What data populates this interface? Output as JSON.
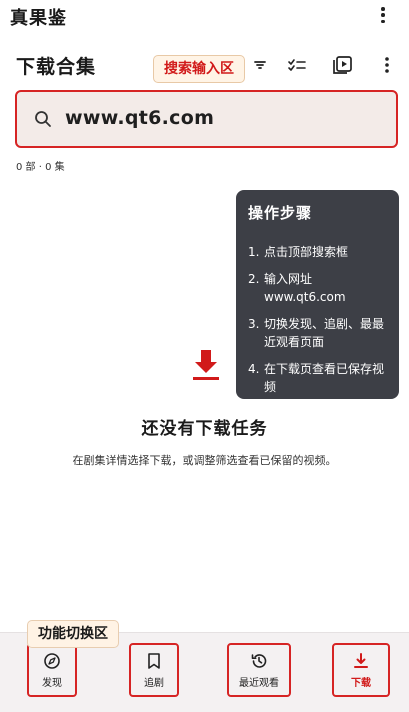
{
  "app": {
    "title": "真果鉴"
  },
  "header": {
    "title": "下载合集"
  },
  "annotations": {
    "search_area": "搜索输入区",
    "function_switch": "功能切换区"
  },
  "search": {
    "value": "www.qt6.com"
  },
  "status": {
    "count": "0 部 · 0 集"
  },
  "steps": {
    "title": "操作步骤",
    "items": [
      {
        "num": "1.",
        "text": "点击顶部搜索框"
      },
      {
        "num": "2.",
        "text": "输入网址 www.qt6.com"
      },
      {
        "num": "3.",
        "text": "切换发现、追剧、最最近观看页面"
      },
      {
        "num": "4.",
        "text": "在下载页查看已保存视频"
      }
    ]
  },
  "empty": {
    "title": "还没有下载任务",
    "subtitle": "在剧集详情选择下载，或调整筛选查看已保留的视频。"
  },
  "nav": {
    "items": [
      {
        "label": "发现",
        "icon": "compass-icon"
      },
      {
        "label": "追剧",
        "icon": "bookmark-icon"
      },
      {
        "label": "最近观看",
        "icon": "history-icon"
      },
      {
        "label": "下载",
        "icon": "download-icon",
        "active": true
      }
    ]
  },
  "colors": {
    "accent": "#d11a1a",
    "tooltip_bg": "#3d3f46",
    "search_bg": "#f3ebe8",
    "nav_bg": "#f4f1f2"
  }
}
